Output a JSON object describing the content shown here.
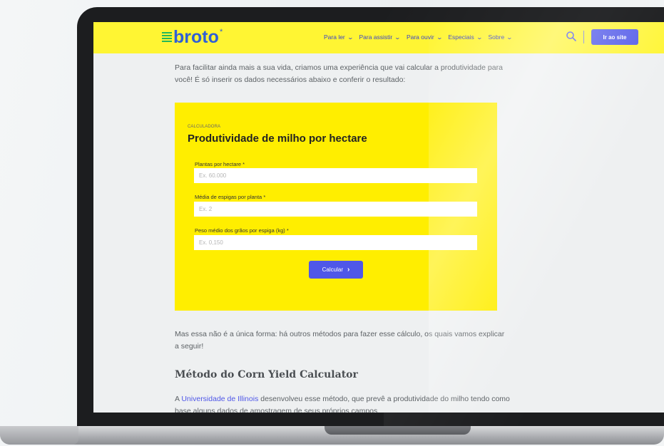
{
  "site": {
    "logo_text": "broto",
    "logo_star": "*",
    "nav_items": [
      "Para ler",
      "Para assistir",
      "Para ouvir",
      "Especiais",
      "Sobre"
    ],
    "cta_label": "Ir ao site",
    "chevron_glyph": "⌄"
  },
  "article": {
    "intro": "Para facilitar ainda mais a sua vida, criamos uma experiência que vai calcular a produtividade para você! É só inserir os dados necessários abaixo e conferir o resultado:",
    "after_calc": "Mas essa não é a única forma: há outros métodos para fazer esse cálculo, os quais vamos explicar a seguir!",
    "section_title": "Método do Corn Yield Calculator",
    "para3_prefix": "A ",
    "para3_link": "Universidade de Illinois",
    "para3_suffix": " desenvolveu esse método, que prevê a produtividade do milho tendo como base alguns dados de amostragem de seus próprios campos."
  },
  "calculator": {
    "eyebrow": "CALCULADORA",
    "title": "Produtividade de milho por hectare",
    "fields": [
      {
        "label": "Plantas por hectare *",
        "placeholder": "Ex. 60.000"
      },
      {
        "label": "Média de espigas por planta *",
        "placeholder": "Ex. 2"
      },
      {
        "label": "Peso médio dos grãos por espiga (kg) *",
        "placeholder": "Ex. 0,150"
      }
    ],
    "button_label": "Calcular",
    "button_arrow": "›"
  },
  "colors": {
    "nav_bg": "#fff533",
    "calc_bg": "#ffee00",
    "accent": "#4f57e8",
    "logo": "#2f5fd6",
    "logo_mark": "#23b85a"
  },
  "icons": {
    "logo_mark": "logo-mark-icon",
    "search": "search-icon",
    "chevron": "chevron-down-icon",
    "arrow": "arrow-right-icon"
  }
}
